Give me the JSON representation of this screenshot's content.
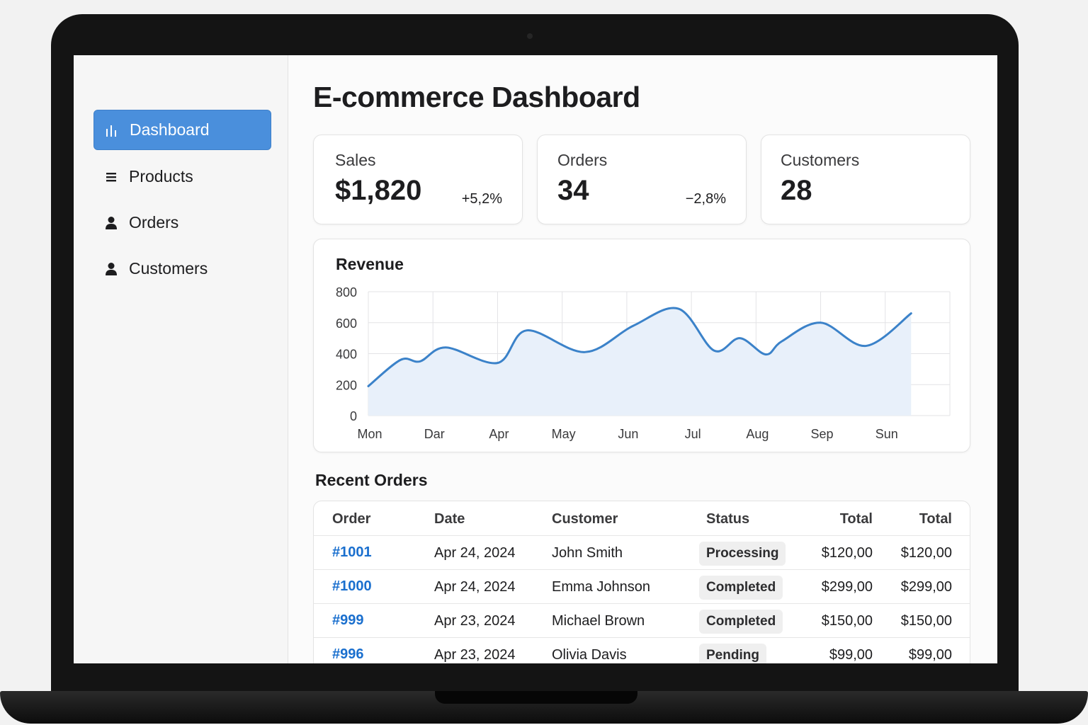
{
  "sidebar": {
    "items": [
      {
        "label": "Dashboard",
        "icon": "bar-chart-icon",
        "active": true
      },
      {
        "label": "Products",
        "icon": "list-icon",
        "active": false
      },
      {
        "label": "Orders",
        "icon": "person-icon",
        "active": false
      },
      {
        "label": "Customers",
        "icon": "person-icon",
        "active": false
      }
    ]
  },
  "page": {
    "title": "E-commerce Dashboard"
  },
  "stats": [
    {
      "label": "Sales",
      "value": "$1,820",
      "change": "+5,2%"
    },
    {
      "label": "Orders",
      "value": "34",
      "change": "−2,8%"
    },
    {
      "label": "Customers",
      "value": "28",
      "change": ""
    }
  ],
  "revenue": {
    "title": "Revenue",
    "colors": {
      "line": "#3b82c9",
      "fill": "#e8f0fa",
      "grid": "#e3e3e6"
    }
  },
  "chart_data": {
    "type": "area",
    "title": "Revenue",
    "categories": [
      "Mon",
      "Dar",
      "Apr",
      "May",
      "Jun",
      "Jul",
      "Aug",
      "Sep",
      "Sun"
    ],
    "yticks": [
      0,
      200,
      400,
      600,
      800
    ],
    "ylim": [
      0,
      800
    ],
    "grid": true,
    "series": [
      {
        "x": [
          0,
          0.5,
          0.8,
          1.2,
          2.0,
          2.45,
          3.35,
          4.1,
          4.8,
          5.35,
          5.75,
          6.15,
          6.4,
          7.0,
          7.7,
          8.4
        ],
        "y": [
          190,
          360,
          350,
          440,
          340,
          550,
          410,
          580,
          690,
          420,
          500,
          395,
          480,
          600,
          450,
          660
        ]
      }
    ]
  },
  "recent_orders": {
    "title": "Recent Orders",
    "columns": [
      "Order",
      "Date",
      "Customer",
      "Status",
      "Total",
      "Total"
    ],
    "rows": [
      {
        "order": "#1001",
        "date": "Apr 24, 2024",
        "customer": "John Smith",
        "status": "Processing",
        "total1": "$120,00",
        "total2": "$120,00"
      },
      {
        "order": "#1000",
        "date": "Apr 24, 2024",
        "customer": "Emma Johnson",
        "status": "Completed",
        "total1": "$299,00",
        "total2": "$299,00"
      },
      {
        "order": "#999",
        "date": "Apr 23, 2024",
        "customer": "Michael Brown",
        "status": "Completed",
        "total1": "$150,00",
        "total2": "$150,00"
      },
      {
        "order": "#996",
        "date": "Apr 23, 2024",
        "customer": "Olivia Davis",
        "status": "Pending",
        "total1": "$99,00",
        "total2": "$99,00"
      }
    ]
  }
}
